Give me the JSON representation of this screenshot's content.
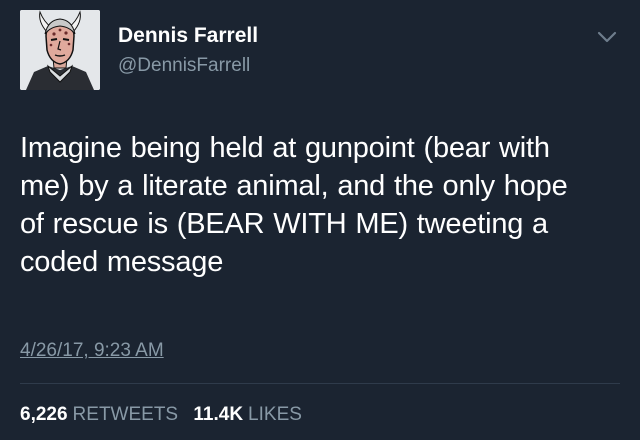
{
  "tweet": {
    "author": {
      "name": "Dennis Farrell",
      "handle": "@DennisFarrell",
      "avatar_icon": "comic-character-avatar"
    },
    "menu_icon": "chevron-down-icon",
    "text_lines": [
      "Imagine being held at gunpoint (bear with",
      "me) by a literate animal, and the only hope",
      "of rescue is (BEAR WITH ME) tweeting a",
      "coded message"
    ],
    "timestamp": "4/26/17, 9:23 AM",
    "retweets": {
      "count": "6,226",
      "label": "RETWEETS"
    },
    "likes": {
      "count": "11.4K",
      "label": "LIKES"
    }
  },
  "colors": {
    "background": "#1b2431",
    "primary_text": "#ffffff",
    "secondary_text": "#8899a6",
    "divider": "#2f3b4b"
  }
}
